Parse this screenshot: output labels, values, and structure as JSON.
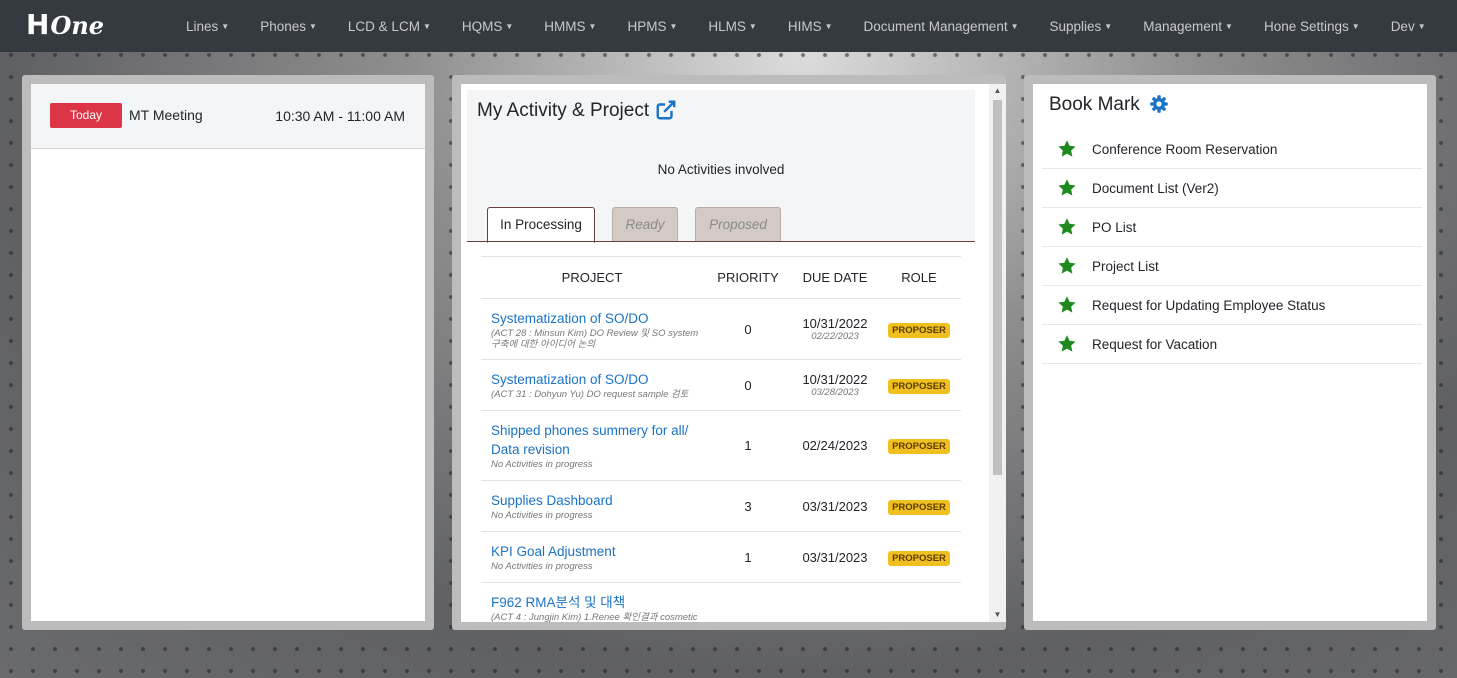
{
  "navbar": {
    "brand_h": "H",
    "brand_one": "One",
    "items": [
      "Lines",
      "Phones",
      "LCD & LCM",
      "HQMS",
      "HMMS",
      "HPMS",
      "HLMS",
      "HIMS",
      "Document Management",
      "Supplies",
      "Management",
      "Hone Settings",
      "Dev"
    ]
  },
  "schedule": {
    "today_label": "Today",
    "meeting_title": "MT Meeting",
    "meeting_time": "10:30 AM - 11:00 AM"
  },
  "activity": {
    "title": "My Activity & Project",
    "empty_text": "No Activities involved",
    "tabs": [
      "In Processing",
      "Ready",
      "Proposed"
    ],
    "columns": [
      "PROJECT",
      "PRIORITY",
      "DUE DATE",
      "ROLE"
    ],
    "rows": [
      {
        "name": "Systematization of SO/DO",
        "sub": "(ACT 28 : Minsun Kim) DO Review 및 SO system 구축에 대한 아이디어 논의",
        "priority": "0",
        "due": "10/31/2022",
        "due2": "02/22/2023",
        "role": "PROPOSER"
      },
      {
        "name": "Systematization of SO/DO",
        "sub": "(ACT 31 : Dohyun Yu) DO request sample 검토",
        "priority": "0",
        "due": "10/31/2022",
        "due2": "03/28/2023",
        "role": "PROPOSER"
      },
      {
        "name": "Shipped phones summery for all/ Data revision",
        "sub": "No Activities in progress",
        "priority": "1",
        "due": "02/24/2023",
        "due2": "",
        "role": "PROPOSER"
      },
      {
        "name": "Supplies Dashboard",
        "sub": "No Activities in progress",
        "priority": "3",
        "due": "03/31/2023",
        "due2": "",
        "role": "PROPOSER"
      },
      {
        "name": "KPI Goal Adjustment",
        "sub": "No Activities in progress",
        "priority": "1",
        "due": "03/31/2023",
        "due2": "",
        "role": "PROPOSER"
      },
      {
        "name": "F962 RMA분석 및 대책",
        "sub": "(ACT 4 : Jungjin Kim) 1.Renee 확인결과 cosmetic",
        "priority": "",
        "due": "",
        "due2": "",
        "role": ""
      }
    ]
  },
  "bookmark": {
    "title": "Book Mark",
    "items": [
      "Conference Room Reservation",
      "Document List (Ver2)",
      "PO List",
      "Project List",
      "Request for Updating Employee Status",
      "Request for Vacation"
    ]
  },
  "colors": {
    "navbar": "#343a40",
    "today_badge": "#dc3545",
    "link": "#1a73c6",
    "star": "#1e8a1e",
    "role_badge": "#f0c020"
  },
  "icons": {
    "external_link": "external-link-icon",
    "settings": "gear-icon",
    "bookmark": "star-icon"
  }
}
